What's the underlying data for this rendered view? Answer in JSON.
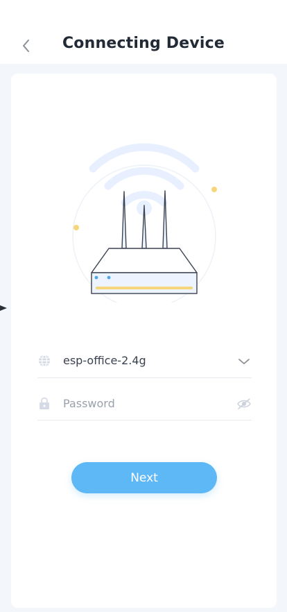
{
  "header": {
    "title": "Connecting Device",
    "back_icon": "chevron-left-icon"
  },
  "form": {
    "network": {
      "icon": "globe-icon",
      "value": "esp-office-2.4g",
      "dropdown_icon": "chevron-down-icon"
    },
    "password": {
      "icon": "lock-icon",
      "placeholder": "Password",
      "value": "",
      "toggle_icon": "eye-icon"
    }
  },
  "actions": {
    "next_label": "Next"
  },
  "illustration": {
    "name": "router-wifi-illustration"
  },
  "colors": {
    "accent": "#5db8f5",
    "wave": "#e8f0ff",
    "dot": "#f6d67a",
    "page_bg": "#f3f6fb"
  }
}
